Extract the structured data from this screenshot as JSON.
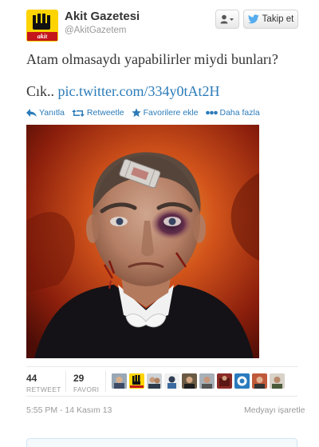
{
  "account": {
    "name": "Akit Gazetesi",
    "handle": "@AkitGazetem",
    "avatar_logo_text": "akit"
  },
  "header_buttons": {
    "follow_label": "Takip et"
  },
  "tweet": {
    "text": "Atam olmasaydı yapabilirler miydi bunları?",
    "link_prefix": "Cık..",
    "link_text": "pic.twitter.com/334y0tAt2H"
  },
  "actions": {
    "reply": "Yanıtla",
    "retweet": "Retweetle",
    "favorite": "Favorilere ekle",
    "more": "Daha fazla"
  },
  "stats": {
    "retweets_count": "44",
    "retweets_label": "RETWEET",
    "favorites_count": "29",
    "favorites_label": "FAVORI"
  },
  "footer": {
    "timestamp": "5:55 PM - 14 Kasım 13",
    "flag_media": "Medyayı işaretle"
  },
  "colors": {
    "link": "#2b7bb9",
    "muted": "#999999",
    "brand_yellow": "#fdd400",
    "brand_red": "#c4161c"
  },
  "icons": [
    "user-menu-icon",
    "twitter-bird-icon",
    "reply-icon",
    "retweet-icon",
    "star-icon",
    "more-dots-icon"
  ]
}
